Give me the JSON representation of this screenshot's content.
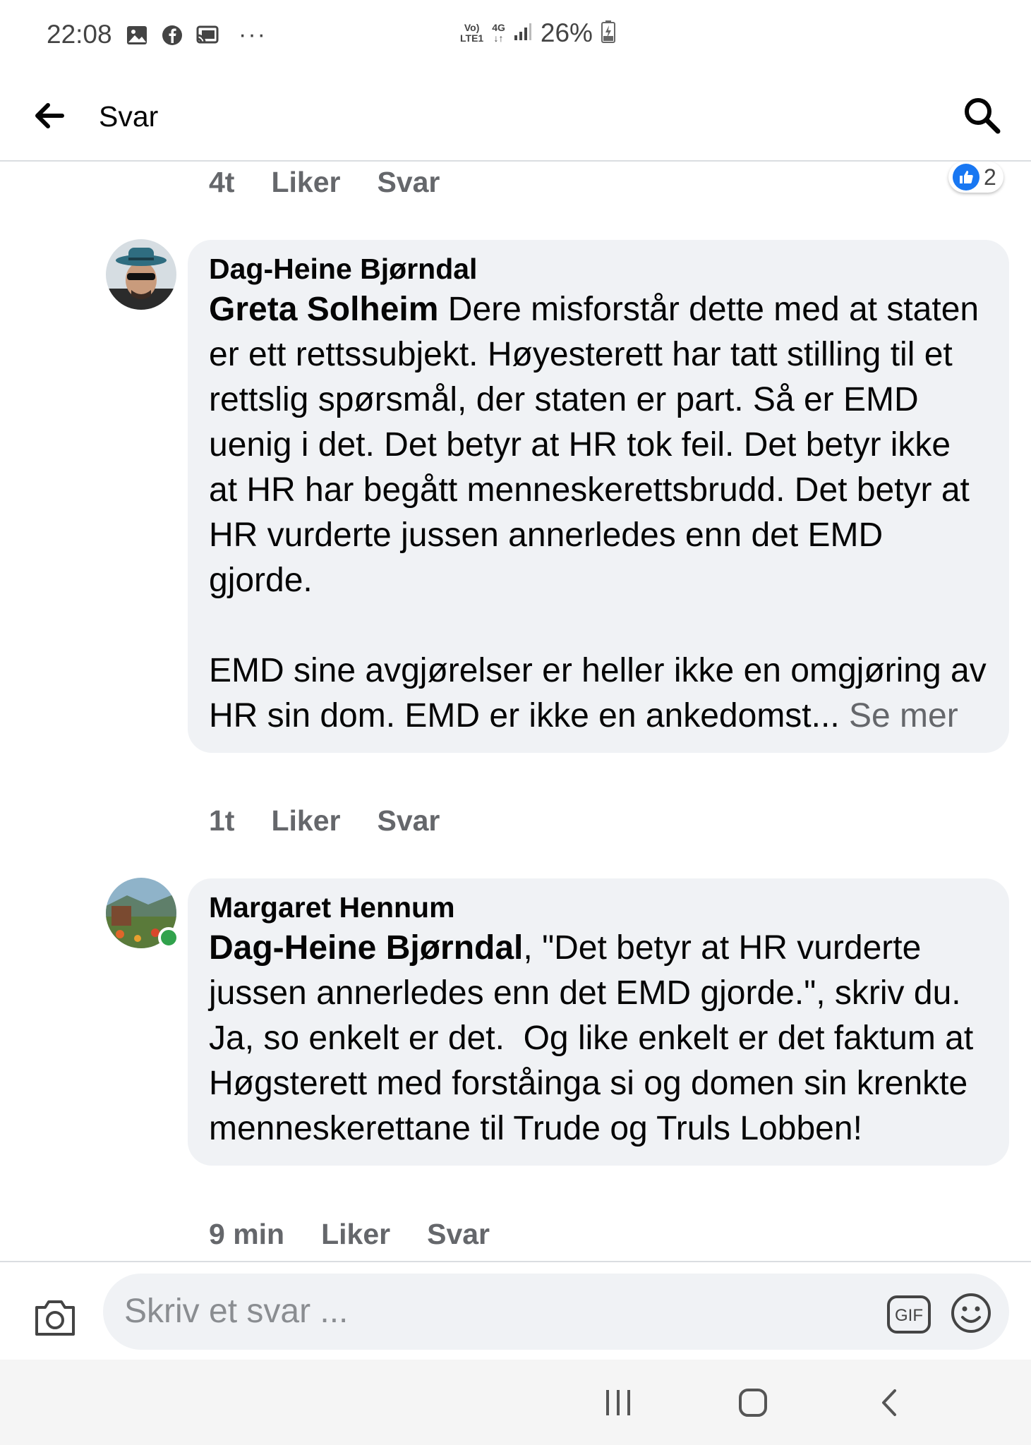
{
  "status_bar": {
    "time": "22:08",
    "network_top": "Vo)",
    "network_bottom": "LTE1",
    "net4g_top": "4G",
    "net4g_bottom": "↓↑",
    "battery": "26%"
  },
  "app_bar": {
    "title": "Svar"
  },
  "comments": [
    {
      "time": "4t",
      "like_label": "Liker",
      "reply_label": "Svar",
      "reaction_count": "2"
    },
    {
      "author": "Dag-Heine Bjørndal",
      "mention": "Greta Solheim",
      "text": " Dere misforstår dette med at staten er ett rettssubjekt. Høyesterett har tatt stilling til et rettslig spørsmål, der staten er part. Så er EMD uenig i det. Det betyr at HR tok feil. Det betyr ikke at HR har begått menneskerettsbrudd. Det betyr at HR vurderte jussen annerledes enn det EMD gjorde.\n\nEMD sine avgjørelser er heller ikke en omgjøring av HR sin dom. EMD er ikke en ankedomst...",
      "see_more": " Se mer",
      "time": "1t",
      "like_label": "Liker",
      "reply_label": "Svar"
    },
    {
      "author": "Margaret Hennum",
      "mention": "Dag-Heine Bjørndal",
      "text": ", \"Det betyr at HR vurderte jussen annerledes enn det EMD gjorde.\", skriv du. Ja, so enkelt er det.  Og like enkelt er det faktum at Høgsterett med forståinga si og domen sin krenkte menneskerettane til Trude og Truls Lobben!",
      "time": "9 min",
      "like_label": "Liker",
      "reply_label": "Svar"
    }
  ],
  "composer": {
    "placeholder": "Skriv et svar ...",
    "gif_label": "GIF"
  },
  "colors": {
    "accent": "#1877f2",
    "bubble": "#f0f2f5",
    "secondary_text": "#65676b",
    "online": "#31a24c"
  }
}
